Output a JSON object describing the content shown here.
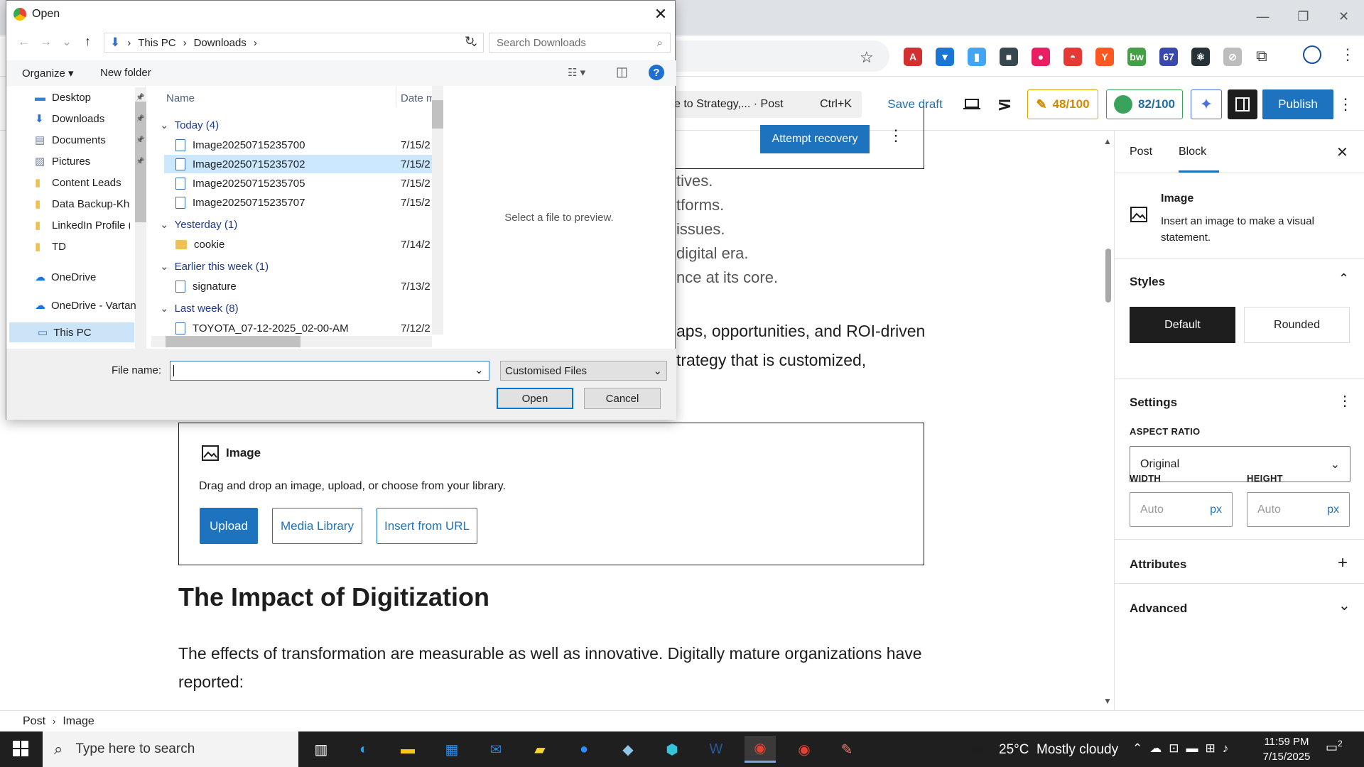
{
  "browser": {
    "window_controls": [
      "—",
      "❐",
      "✕"
    ],
    "extensions": [
      {
        "name": "pdf-ext-icon",
        "color": "#d32f2f",
        "glyph": "A"
      },
      {
        "name": "shield-ext-icon",
        "color": "#1976d2",
        "glyph": "▼"
      },
      {
        "name": "doc-ext-icon",
        "color": "#42a5f5",
        "glyph": "▮"
      },
      {
        "name": "video-ext-icon",
        "color": "#37474f",
        "glyph": "■"
      },
      {
        "name": "color-ext-icon",
        "color": "#e91e63",
        "glyph": "●"
      },
      {
        "name": "ball-ext-icon",
        "color": "#e53935",
        "glyph": "◓"
      },
      {
        "name": "ai-ext-icon",
        "color": "#ff5722",
        "glyph": "Y"
      },
      {
        "name": "bw-ext-icon",
        "color": "#43a047",
        "glyph": "bw"
      },
      {
        "name": "hat-ext-icon",
        "color": "#3949ab",
        "glyph": "67"
      },
      {
        "name": "react-ext-icon",
        "color": "#263238",
        "glyph": "⚛"
      },
      {
        "name": "compass-ext-icon",
        "color": "#bdbdbd",
        "glyph": "⊘"
      }
    ]
  },
  "editor_header": {
    "command_title": "e to Strategy,... · Post",
    "command_shortcut": "Ctrl+K",
    "save_draft": "Save draft",
    "score_1": "48/100",
    "score_2": "82/100",
    "publish": "Publish"
  },
  "content": {
    "attempt_recovery": "Attempt recovery",
    "para_lines": [
      "tives.",
      "tforms.",
      "issues.",
      "digital era.",
      "nce at its core."
    ],
    "para2_lines": [
      "aps, opportunities, and ROI-driven",
      "trategy that is customized,"
    ],
    "image_block": {
      "title": "Image",
      "instructions": "Drag and drop an image, upload, or choose from your library.",
      "upload": "Upload",
      "media_library": "Media Library",
      "insert_url": "Insert from URL"
    },
    "heading": "The Impact of Digitization",
    "body": "The effects of transformation are measurable as well as innovative. Digitally mature organizations have reported:"
  },
  "sidebar": {
    "tabs": [
      "Post",
      "Block"
    ],
    "active_tab": "Block",
    "block_title": "Image",
    "block_desc": "Insert an image to make a visual statement.",
    "styles_title": "Styles",
    "style_default": "Default",
    "style_rounded": "Rounded",
    "settings_title": "Settings",
    "aspect_label": "ASPECT RATIO",
    "aspect_value": "Original",
    "width_label": "WIDTH",
    "height_label": "HEIGHT",
    "width_placeholder": "Auto",
    "height_placeholder": "Auto",
    "unit": "px",
    "attributes": "Attributes",
    "advanced": "Advanced"
  },
  "breadcrumb": {
    "root": "Post",
    "current": "Image"
  },
  "taskbar": {
    "search_placeholder": "Type here to search",
    "weather": "25°C  Mostly cloudy",
    "time": "11:59 PM",
    "date": "7/15/2025",
    "notifications": "2"
  },
  "dialog": {
    "title": "Open",
    "address": [
      "This PC",
      "Downloads"
    ],
    "search_placeholder": "Search Downloads",
    "organize": "Organize ▾",
    "new_folder": "New folder",
    "nav_items": [
      {
        "label": "Desktop",
        "pin": true,
        "icon": "desktop-icon"
      },
      {
        "label": "Downloads",
        "pin": true,
        "icon": "download-icon"
      },
      {
        "label": "Documents",
        "pin": true,
        "icon": "documents-icon"
      },
      {
        "label": "Pictures",
        "pin": true,
        "icon": "pictures-icon"
      },
      {
        "label": "Content Leads",
        "pin": false,
        "icon": "folder-icon"
      },
      {
        "label": "Data Backup-Khu",
        "pin": false,
        "icon": "folder-icon"
      },
      {
        "label": "LinkedIn Profile (",
        "pin": false,
        "icon": "folder-icon"
      },
      {
        "label": "TD",
        "pin": false,
        "icon": "folder-icon"
      }
    ],
    "onedrive_1": "OneDrive",
    "onedrive_2": "OneDrive - Vartan",
    "this_pc": "This PC",
    "col_name": "Name",
    "col_date": "Date m",
    "groups": [
      {
        "label": "Today (4)",
        "files": [
          {
            "name": "Image20250715235700",
            "date": "7/15/2",
            "type": "file"
          },
          {
            "name": "Image20250715235702",
            "date": "7/15/2",
            "type": "file",
            "selected": true
          },
          {
            "name": "Image20250715235705",
            "date": "7/15/2",
            "type": "file"
          },
          {
            "name": "Image20250715235707",
            "date": "7/15/2",
            "type": "file"
          }
        ]
      },
      {
        "label": "Yesterday (1)",
        "files": [
          {
            "name": "cookie",
            "date": "7/14/2",
            "type": "folder"
          }
        ]
      },
      {
        "label": "Earlier this week (1)",
        "files": [
          {
            "name": "signature",
            "date": "7/13/2",
            "type": "file"
          }
        ]
      },
      {
        "label": "Last week (8)",
        "files": [
          {
            "name": "TOYOTA_07-12-2025_02-00-AM",
            "date": "7/12/2",
            "type": "file"
          }
        ]
      }
    ],
    "preview_text": "Select a file to preview.",
    "filename_label": "File name:",
    "filetype": "Customised Files",
    "open_btn": "Open",
    "cancel_btn": "Cancel"
  }
}
